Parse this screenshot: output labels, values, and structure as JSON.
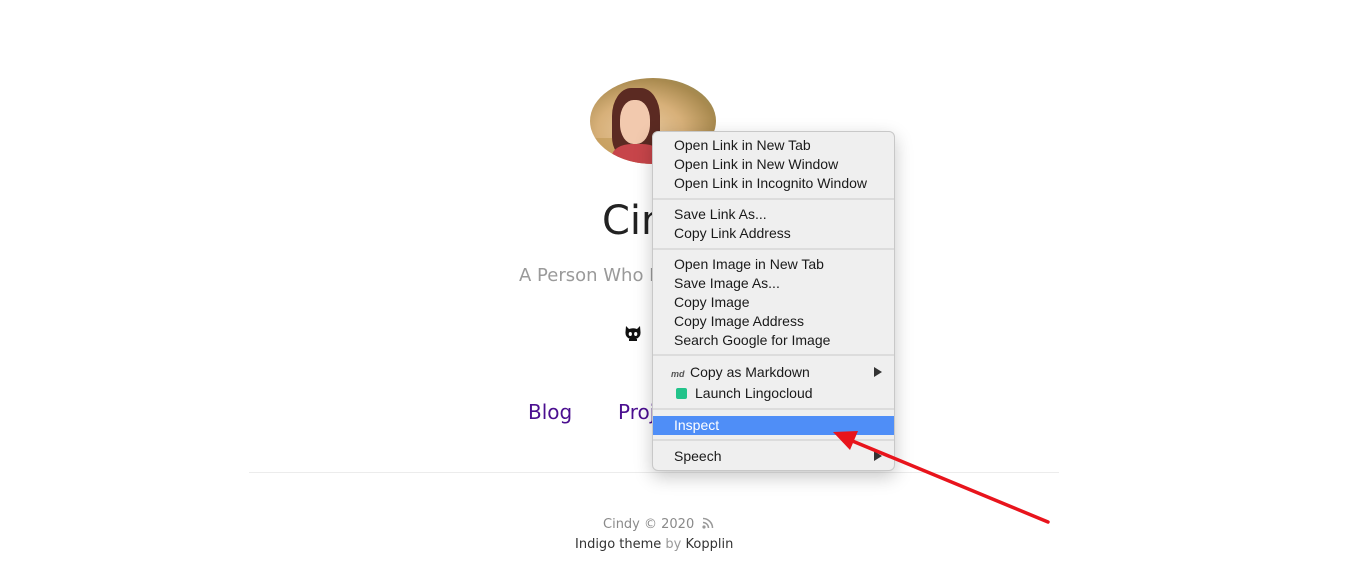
{
  "site": {
    "title": "Cindy",
    "description": "A Person Who L",
    "nav": [
      "Blog",
      "Proj"
    ]
  },
  "footer": {
    "copyright": "Cindy © 2020",
    "theme": "Indigo theme",
    "by": "by",
    "author": "Kopplin"
  },
  "context_menu": {
    "groups": [
      [
        "Open Link in New Tab",
        "Open Link in New Window",
        "Open Link in Incognito Window"
      ],
      [
        "Save Link As...",
        "Copy Link Address"
      ],
      [
        "Open Image in New Tab",
        "Save Image As...",
        "Copy Image",
        "Copy Image Address",
        "Search Google for Image"
      ],
      [
        "Copy as Markdown",
        "Launch Lingocloud"
      ],
      [
        "Inspect"
      ],
      [
        "Speech"
      ]
    ],
    "highlighted": "Inspect",
    "submenu_items": [
      "Copy as Markdown",
      "Speech"
    ],
    "md_badge": "md"
  },
  "colors": {
    "nav_link": "#4b0f90",
    "highlight": "#4f8ef7",
    "annotation_arrow": "#e8141c"
  },
  "icons": [
    "github-icon",
    "rss-icon",
    "markdown-icon",
    "lingocloud-icon",
    "submenu-arrow-icon"
  ]
}
